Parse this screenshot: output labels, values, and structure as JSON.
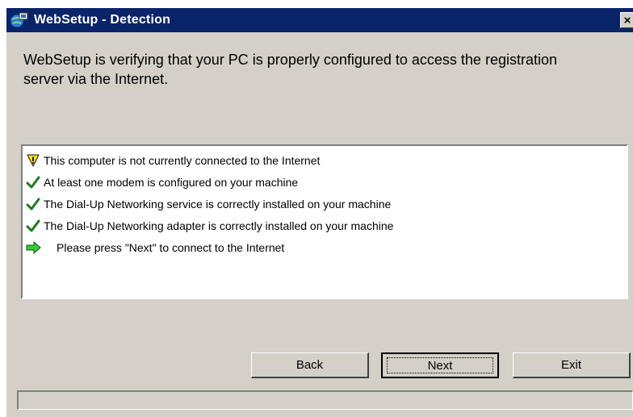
{
  "window": {
    "title": "WebSetup - Detection",
    "close_label": "×"
  },
  "intro_text": "WebSetup is verifying that your PC is properly configured to access the registration server via the Internet.",
  "status_items": [
    {
      "icon": "warning-icon",
      "text": "This computer is not currently connected to the Internet"
    },
    {
      "icon": "checkmark-icon",
      "text": "At least one modem is configured on your machine"
    },
    {
      "icon": "checkmark-icon",
      "text": "The Dial-Up Networking service is correctly installed on your machine"
    },
    {
      "icon": "checkmark-icon",
      "text": "The Dial-Up Networking adapter is correctly installed on your machine"
    },
    {
      "icon": "arrow-right-icon",
      "text": "Please press \"Next\" to connect to the Internet"
    }
  ],
  "buttons": {
    "back": "Back",
    "next": "Next",
    "exit": "Exit"
  },
  "status_bar": "",
  "colors": {
    "titlebar": "#0a246a",
    "dialog_bg": "#d4d0c8",
    "check_green": "#1e7b1e",
    "warning_yellow": "#ffe400",
    "arrow_green": "#33cc33"
  }
}
